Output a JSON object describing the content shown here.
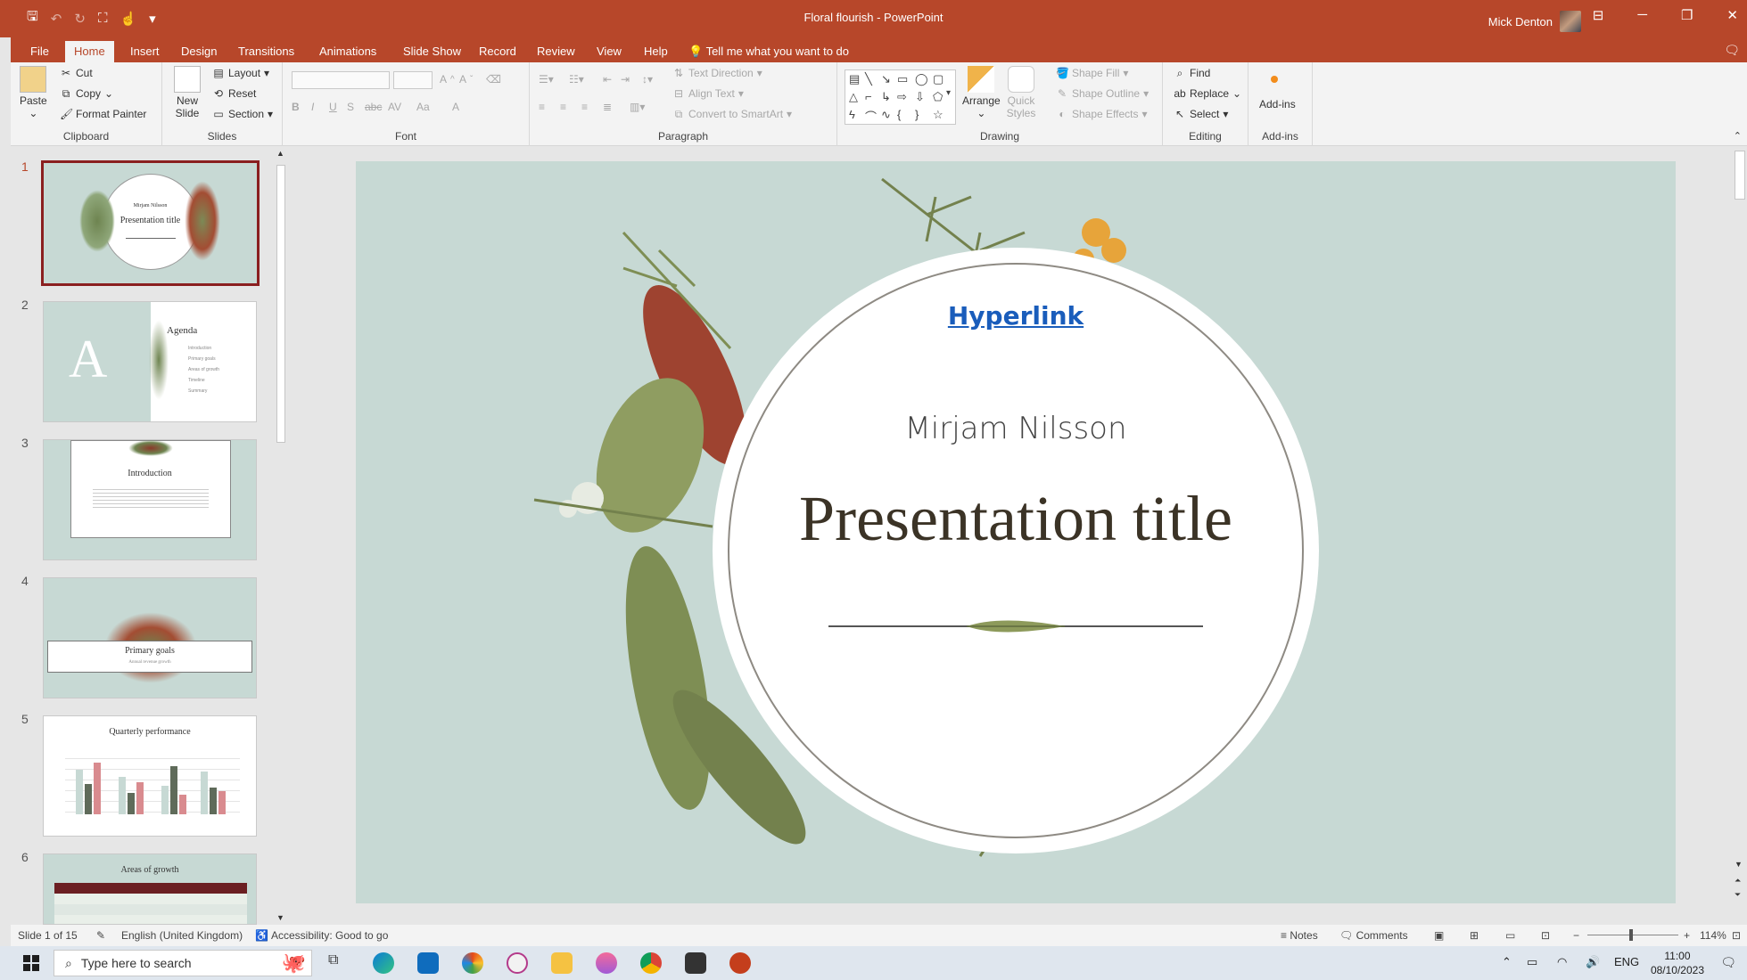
{
  "window": {
    "doc_title": "Floral flourish  -  PowerPoint",
    "user_name": "Mick Denton"
  },
  "tabs": [
    "File",
    "Home",
    "Insert",
    "Design",
    "Transitions",
    "Animations",
    "Slide Show",
    "Record",
    "Review",
    "View",
    "Help"
  ],
  "tell_me": "Tell me what you want to do",
  "ribbon": {
    "clipboard": {
      "paste": "Paste",
      "cut": "Cut",
      "copy": "Copy",
      "format_painter": "Format Painter",
      "label": "Clipboard"
    },
    "slides": {
      "new_slide": "New Slide",
      "layout": "Layout",
      "reset": "Reset",
      "section": "Section",
      "label": "Slides"
    },
    "font": {
      "label": "Font",
      "bold": "B",
      "italic": "I",
      "underline": "U",
      "shadow": "S",
      "strike": "abc",
      "spacing": "AV",
      "case": "Aa",
      "color": "A"
    },
    "paragraph": {
      "label": "Paragraph",
      "text_direction": "Text Direction",
      "align_text": "Align Text",
      "convert_smartart": "Convert to SmartArt"
    },
    "drawing": {
      "label": "Drawing",
      "arrange": "Arrange",
      "quick_styles": "Quick Styles",
      "shape_fill": "Shape Fill",
      "shape_outline": "Shape Outline",
      "shape_effects": "Shape Effects"
    },
    "editing": {
      "label": "Editing",
      "find": "Find",
      "replace": "Replace",
      "select": "Select"
    },
    "addins": {
      "label": "Add-ins",
      "button": "Add-ins"
    }
  },
  "thumbnails": [
    {
      "num": "1",
      "title": "Presentation title",
      "subtitle": "Mirjam Nilsson"
    },
    {
      "num": "2",
      "title": "Agenda",
      "items": [
        "Introduction",
        "Primary goals",
        "Areas of growth",
        "Timeline",
        "Summary"
      ]
    },
    {
      "num": "3",
      "title": "Introduction"
    },
    {
      "num": "4",
      "title": "Primary goals",
      "subtitle": "Annual revenue growth"
    },
    {
      "num": "5",
      "title": "Quarterly performance"
    },
    {
      "num": "6",
      "title": "Areas of growth"
    }
  ],
  "slide": {
    "hyperlink": "Hyperlink",
    "subtitle": "Mirjam Nilsson",
    "title": "Presentation title"
  },
  "status": {
    "slide_count": "Slide 1 of 15",
    "language": "English (United Kingdom)",
    "accessibility": "Accessibility: Good to go",
    "notes": "Notes",
    "comments": "Comments",
    "zoom": "114%"
  },
  "taskbar": {
    "search_placeholder": "Type here to search",
    "lang": "ENG",
    "time": "11:00",
    "date": "08/10/2023"
  },
  "colors": {
    "accent": "#b7472a",
    "slide_bg": "#c7d9d4",
    "hyperlink": "#1a5dbb"
  }
}
